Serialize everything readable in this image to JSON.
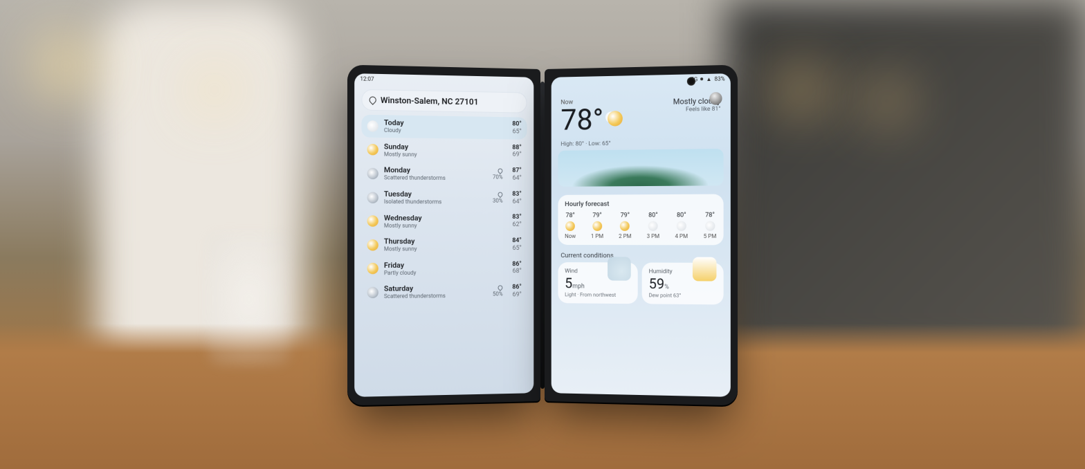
{
  "status": {
    "time": "12:07",
    "network": "5G",
    "battery": "83%"
  },
  "location": "Winston-Salem, NC 27101",
  "forecast": [
    {
      "name": "Today",
      "cond": "Cloudy",
      "icon": "cloud",
      "precip": null,
      "hi": "80°",
      "lo": "65°",
      "selected": true
    },
    {
      "name": "Sunday",
      "cond": "Mostly sunny",
      "icon": "sun",
      "precip": null,
      "hi": "88°",
      "lo": "69°"
    },
    {
      "name": "Monday",
      "cond": "Scattered thunderstorms",
      "icon": "storm",
      "precip": "70%",
      "hi": "87°",
      "lo": "64°"
    },
    {
      "name": "Tuesday",
      "cond": "Isolated thunderstorms",
      "icon": "storm",
      "precip": "30%",
      "hi": "83°",
      "lo": "64°"
    },
    {
      "name": "Wednesday",
      "cond": "Mostly sunny",
      "icon": "sun",
      "precip": null,
      "hi": "83°",
      "lo": "62°"
    },
    {
      "name": "Thursday",
      "cond": "Mostly sunny",
      "icon": "sun",
      "precip": null,
      "hi": "84°",
      "lo": "65°"
    },
    {
      "name": "Friday",
      "cond": "Partly cloudy",
      "icon": "sun",
      "precip": null,
      "hi": "86°",
      "lo": "68°"
    },
    {
      "name": "Saturday",
      "cond": "Scattered thunderstorms",
      "icon": "storm",
      "precip": "50%",
      "hi": "86°",
      "lo": "69°"
    }
  ],
  "now": {
    "label": "Now",
    "temp": "78°",
    "condition": "Mostly cloudy",
    "feels_like": "Feels like 81°",
    "high_low": "High: 80° · Low: 65°"
  },
  "hourly": {
    "title": "Hourly forecast",
    "items": [
      {
        "temp": "78°",
        "time": "Now",
        "icon": "sun"
      },
      {
        "temp": "79°",
        "time": "1 PM",
        "icon": "sun"
      },
      {
        "temp": "79°",
        "time": "2 PM",
        "icon": "sun"
      },
      {
        "temp": "80°",
        "time": "3 PM",
        "icon": "later"
      },
      {
        "temp": "80°",
        "time": "4 PM",
        "icon": "later"
      },
      {
        "temp": "78°",
        "time": "5 PM",
        "icon": "later"
      }
    ]
  },
  "conditions": {
    "title": "Current conditions",
    "wind": {
      "label": "Wind",
      "value": "5",
      "unit": "mph",
      "sub": "Light · From northwest"
    },
    "humidity": {
      "label": "Humidity",
      "value": "59",
      "unit": "%",
      "sub": "Dew point 63°"
    }
  }
}
